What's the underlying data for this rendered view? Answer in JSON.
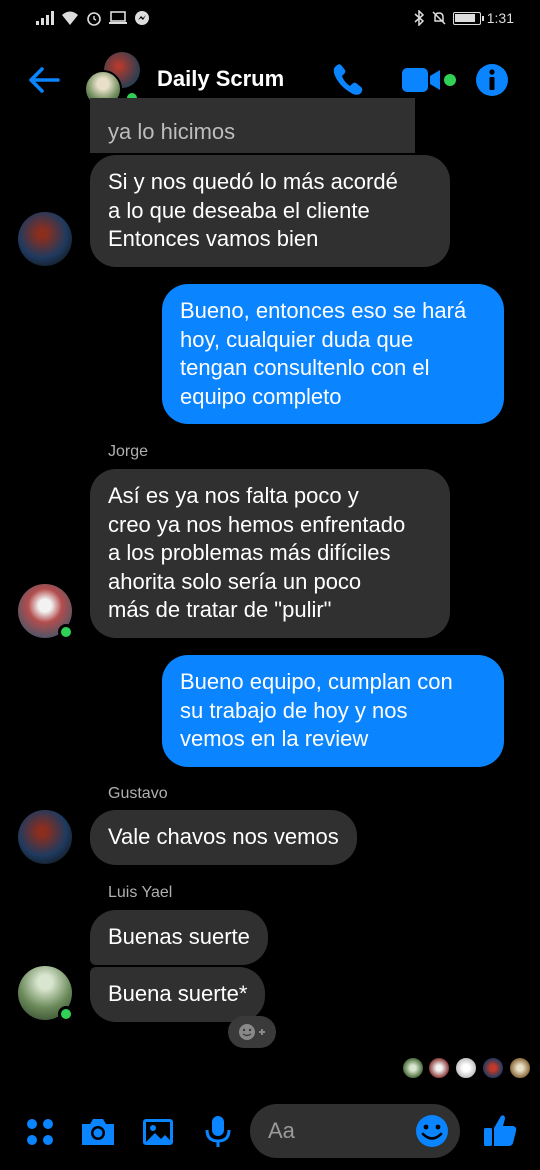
{
  "status_bar": {
    "time": "1:31"
  },
  "header": {
    "title": "Daily Scrum"
  },
  "colors": {
    "accent": "#0a84ff",
    "incoming_bubble": "#303030",
    "online": "#31d158"
  },
  "messages": {
    "m0": "ya lo hicimos",
    "m1": "Si y nos quedó lo más acordé\na lo que deseaba el cliente\nEntonces vamos bien",
    "m2": "Bueno, entonces eso se hará\nhoy, cualquier duda que\ntengan consultenlo con el\nequipo completo",
    "sender_jorge": "Jorge",
    "m3": "Así es ya nos falta poco y\ncreo ya nos hemos enfrentado\na los problemas más difíciles\nahorita solo sería un poco\nmás de tratar de \"pulir\"",
    "m4": "Bueno equipo, cumplan con\nsu trabajo de hoy y nos\nvemos en la review",
    "sender_gustavo": "Gustavo",
    "m5": "Vale chavos nos vemos",
    "sender_luis": "Luis Yael",
    "m6": "Buenas suerte",
    "m7": "Buena suerte*"
  },
  "composer": {
    "placeholder": "Aa"
  },
  "icons": {
    "back": "back-arrow-icon",
    "call": "phone-icon",
    "video": "video-camera-icon",
    "info": "info-icon",
    "menu": "four-dots-icon",
    "camera": "camera-icon",
    "gallery": "image-icon",
    "mic": "microphone-icon",
    "emoji": "emoji-icon",
    "like": "thumbs-up-icon"
  }
}
